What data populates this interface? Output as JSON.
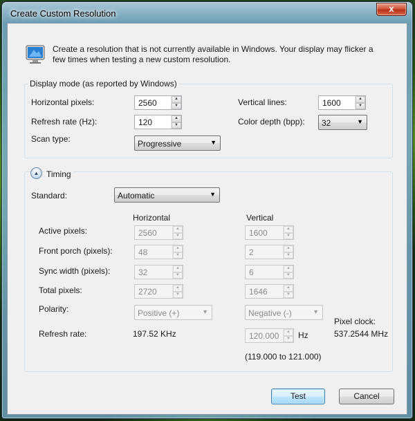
{
  "window": {
    "title": "Create Custom Resolution",
    "close_glyph": "x"
  },
  "intro": {
    "icon": "monitor-icon",
    "text": "Create a resolution that is not currently available in Windows. Your display may flicker a few times when testing a new custom resolution."
  },
  "display_mode": {
    "group_label": "Display mode (as reported by Windows)",
    "horizontal_pixels": {
      "label": "Horizontal pixels:",
      "value": "2560"
    },
    "vertical_lines": {
      "label": "Vertical lines:",
      "value": "1600"
    },
    "refresh_rate": {
      "label": "Refresh rate (Hz):",
      "value": "120"
    },
    "color_depth": {
      "label": "Color depth (bpp):",
      "value": "32"
    },
    "scan_type": {
      "label": "Scan type:",
      "value": "Progressive"
    }
  },
  "timing": {
    "group_label": "Timing",
    "toggle_glyph": "▲",
    "standard": {
      "label": "Standard:",
      "value": "Automatic"
    },
    "col_horizontal": "Horizontal",
    "col_vertical": "Vertical",
    "rows": [
      {
        "label": "Active pixels:",
        "h": "2560",
        "v": "1600"
      },
      {
        "label": "Front porch (pixels):",
        "h": "48",
        "v": "2"
      },
      {
        "label": "Sync width (pixels):",
        "h": "32",
        "v": "6"
      },
      {
        "label": "Total pixels:",
        "h": "2720",
        "v": "1646"
      }
    ],
    "polarity": {
      "label": "Polarity:",
      "h": "Positive (+)",
      "v": "Negative (-)"
    },
    "refresh": {
      "label": "Refresh rate:",
      "h": "197.52 KHz",
      "v": "120.000",
      "unit": "Hz",
      "range": "(119.000 to 121.000)"
    },
    "pixel_clock": {
      "label": "Pixel clock:",
      "value": "537.2544 MHz"
    }
  },
  "buttons": {
    "test": "Test",
    "cancel": "Cancel"
  },
  "colors": {
    "accent": "#3c7fb1",
    "close": "#c9442a",
    "panel": "#f0f0f0"
  }
}
